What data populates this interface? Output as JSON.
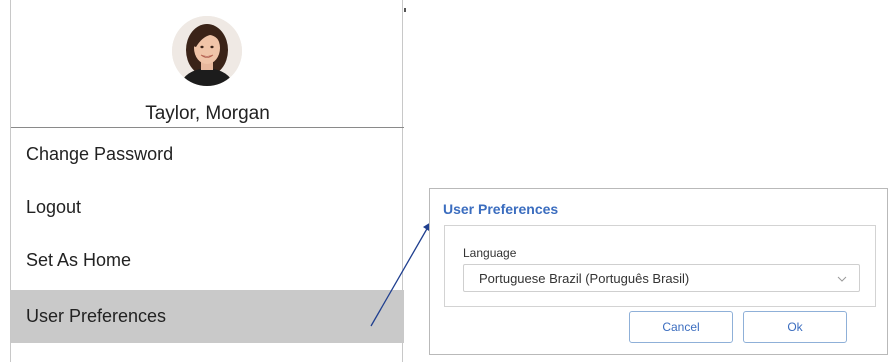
{
  "user_menu": {
    "avatar_icon": "user-avatar-photo",
    "user_name": "Taylor, Morgan",
    "items": [
      {
        "label": "Change Password"
      },
      {
        "label": "Logout"
      },
      {
        "label": "Set As Home"
      },
      {
        "label": "User Preferences",
        "selected": true
      }
    ]
  },
  "preferences_dialog": {
    "title": "User Preferences",
    "language_label": "Language",
    "language_value": "Portuguese Brazil (Português Brasil)",
    "cancel_label": "Cancel",
    "ok_label": "Ok"
  },
  "colors": {
    "accent": "#3b6dbf",
    "selected_item_bg": "#c9c9c9",
    "connector_line": "#1f3f8f"
  }
}
